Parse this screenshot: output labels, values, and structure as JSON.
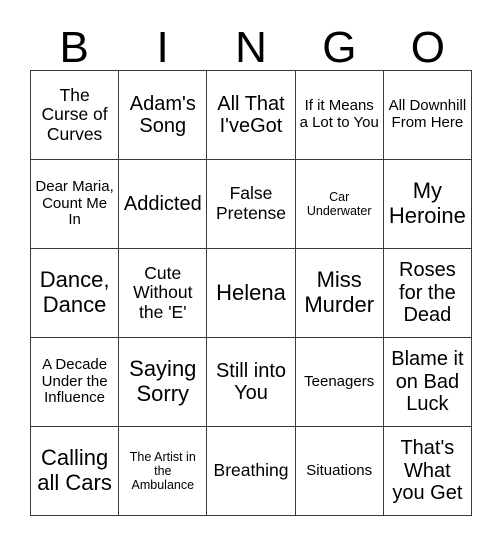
{
  "card": {
    "title_letters": [
      "B",
      "I",
      "N",
      "G",
      "O"
    ],
    "columns": 5,
    "rows": 5,
    "border_color": "#3a3a3a",
    "background_color": "#ffffff",
    "text_color": "#000000",
    "cells": [
      [
        {
          "text": "The Curse of Curves",
          "size": "md"
        },
        {
          "text": "Adam's Song",
          "size": "lg"
        },
        {
          "text": "All That I'veGot",
          "size": "lg"
        },
        {
          "text": "If it Means a Lot to You",
          "size": "sm"
        },
        {
          "text": "All Downhill From Here",
          "size": "sm"
        }
      ],
      [
        {
          "text": "Dear Maria, Count Me In",
          "size": "sm"
        },
        {
          "text": "Addicted",
          "size": "lg"
        },
        {
          "text": "False Pretense",
          "size": "md"
        },
        {
          "text": "Car Underwater",
          "size": "xs"
        },
        {
          "text": "My Heroine",
          "size": "xl"
        }
      ],
      [
        {
          "text": "Dance, Dance",
          "size": "xl"
        },
        {
          "text": "Cute Without the 'E'",
          "size": "md"
        },
        {
          "text": "Helena",
          "size": "xl"
        },
        {
          "text": "Miss Murder",
          "size": "xl"
        },
        {
          "text": "Roses for the Dead",
          "size": "lg"
        }
      ],
      [
        {
          "text": "A Decade Under the Influence",
          "size": "sm"
        },
        {
          "text": "Saying Sorry",
          "size": "xl"
        },
        {
          "text": "Still into You",
          "size": "lg"
        },
        {
          "text": "Teenagers",
          "size": "sm"
        },
        {
          "text": "Blame it on Bad Luck",
          "size": "lg"
        }
      ],
      [
        {
          "text": "Calling all Cars",
          "size": "xl"
        },
        {
          "text": "The Artist in the Ambulance",
          "size": "xs"
        },
        {
          "text": "Breathing",
          "size": "md"
        },
        {
          "text": "Situations",
          "size": "sm"
        },
        {
          "text": "That's What you Get",
          "size": "lg"
        }
      ]
    ]
  }
}
